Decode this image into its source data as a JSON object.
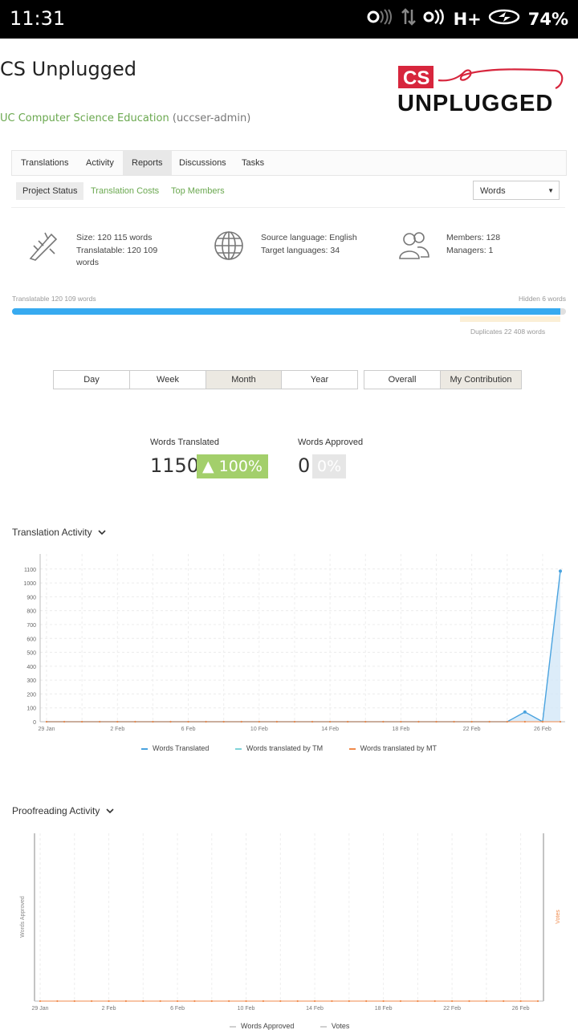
{
  "statusbar": {
    "time": "11:31",
    "network": "H+",
    "battery": "74%"
  },
  "header": {
    "title": "CS Unplugged",
    "org_name": "UC Computer Science Education",
    "org_handle": "(uccser-admin)",
    "logo_top": "CS",
    "logo_bottom": "UNPLUGGED"
  },
  "nav": {
    "tabs": [
      "Translations",
      "Activity",
      "Reports",
      "Discussions",
      "Tasks"
    ],
    "active": "Reports"
  },
  "subnav": {
    "tabs": [
      "Project Status",
      "Translation Costs",
      "Top Members"
    ],
    "active": "Project Status",
    "select_value": "Words"
  },
  "stats": {
    "size": "Size: 120 115 words",
    "translatable_a": "Translatable: 120 109",
    "translatable_b": "words",
    "source_lang": "Source language: English",
    "target_langs": "Target languages: 34",
    "members": "Members: 128",
    "managers": "Managers: 1"
  },
  "progress": {
    "translatable_label": "Translatable 120 109 words",
    "hidden_label": "Hidden 6 words",
    "duplicates_label": "Duplicates 22 408 words",
    "fill_fraction": 0.9999
  },
  "periods": [
    "Day",
    "Week",
    "Month",
    "Year"
  ],
  "period_active": "Month",
  "scopes": [
    "Overall",
    "My Contribution"
  ],
  "scope_active": "My Contribution",
  "metrics": {
    "translated_label": "Words Translated",
    "translated_value": "1150",
    "translated_change": "▲ 100%",
    "approved_label": "Words Approved",
    "approved_value": "0",
    "approved_change": "0%"
  },
  "translation_activity": {
    "title": "Translation Activity",
    "legend": [
      "Words Translated",
      "Words translated by TM",
      "Words translated by MT"
    ],
    "colors": [
      "#4aa3df",
      "#7fd3d8",
      "#f08a4b"
    ]
  },
  "proofreading_activity": {
    "title": "Proofreading Activity",
    "left_axis": "Words Approved",
    "right_axis": "Votes",
    "legend": [
      "Words Approved",
      "Votes"
    ]
  },
  "chart_data": [
    {
      "type": "area",
      "title": "Translation Activity",
      "x_ticks": [
        "29 Jan",
        "2 Feb",
        "6 Feb",
        "10 Feb",
        "14 Feb",
        "18 Feb",
        "22 Feb",
        "26 Feb"
      ],
      "y_ticks": [
        0,
        100,
        200,
        300,
        400,
        500,
        600,
        700,
        800,
        900,
        1000,
        1100
      ],
      "ylim": [
        0,
        1100
      ],
      "x": [
        "29 Jan",
        "30 Jan",
        "31 Jan",
        "1 Feb",
        "2 Feb",
        "3 Feb",
        "4 Feb",
        "5 Feb",
        "6 Feb",
        "7 Feb",
        "8 Feb",
        "9 Feb",
        "10 Feb",
        "11 Feb",
        "12 Feb",
        "13 Feb",
        "14 Feb",
        "15 Feb",
        "16 Feb",
        "17 Feb",
        "18 Feb",
        "19 Feb",
        "20 Feb",
        "21 Feb",
        "22 Feb",
        "23 Feb",
        "24 Feb",
        "25 Feb",
        "26 Feb",
        "27 Feb"
      ],
      "series": [
        {
          "name": "Words Translated",
          "values": [
            0,
            0,
            0,
            0,
            0,
            0,
            0,
            0,
            0,
            0,
            0,
            0,
            0,
            0,
            0,
            0,
            0,
            0,
            0,
            0,
            0,
            0,
            0,
            0,
            0,
            0,
            0,
            70,
            0,
            1085
          ]
        },
        {
          "name": "Words translated by TM",
          "values": [
            0,
            0,
            0,
            0,
            0,
            0,
            0,
            0,
            0,
            0,
            0,
            0,
            0,
            0,
            0,
            0,
            0,
            0,
            0,
            0,
            0,
            0,
            0,
            0,
            0,
            0,
            0,
            0,
            0,
            0
          ]
        },
        {
          "name": "Words translated by MT",
          "values": [
            0,
            0,
            0,
            0,
            0,
            0,
            0,
            0,
            0,
            0,
            0,
            0,
            0,
            0,
            0,
            0,
            0,
            0,
            0,
            0,
            0,
            0,
            0,
            0,
            0,
            0,
            0,
            0,
            0,
            0
          ]
        }
      ],
      "grid": true
    },
    {
      "type": "line",
      "title": "Proofreading Activity",
      "x_ticks": [
        "29 Jan",
        "2 Feb",
        "6 Feb",
        "10 Feb",
        "14 Feb",
        "18 Feb",
        "22 Feb",
        "26 Feb"
      ],
      "ylabel": "Words Approved",
      "y2label": "Votes",
      "series": [
        {
          "name": "Words Approved",
          "values": [
            0,
            0,
            0,
            0,
            0,
            0,
            0,
            0,
            0,
            0,
            0,
            0,
            0,
            0,
            0,
            0,
            0,
            0,
            0,
            0,
            0,
            0,
            0,
            0,
            0,
            0,
            0,
            0,
            0,
            0
          ]
        },
        {
          "name": "Votes",
          "values": [
            0,
            0,
            0,
            0,
            0,
            0,
            0,
            0,
            0,
            0,
            0,
            0,
            0,
            0,
            0,
            0,
            0,
            0,
            0,
            0,
            0,
            0,
            0,
            0,
            0,
            0,
            0,
            0,
            0,
            0
          ]
        }
      ],
      "grid": true
    }
  ]
}
